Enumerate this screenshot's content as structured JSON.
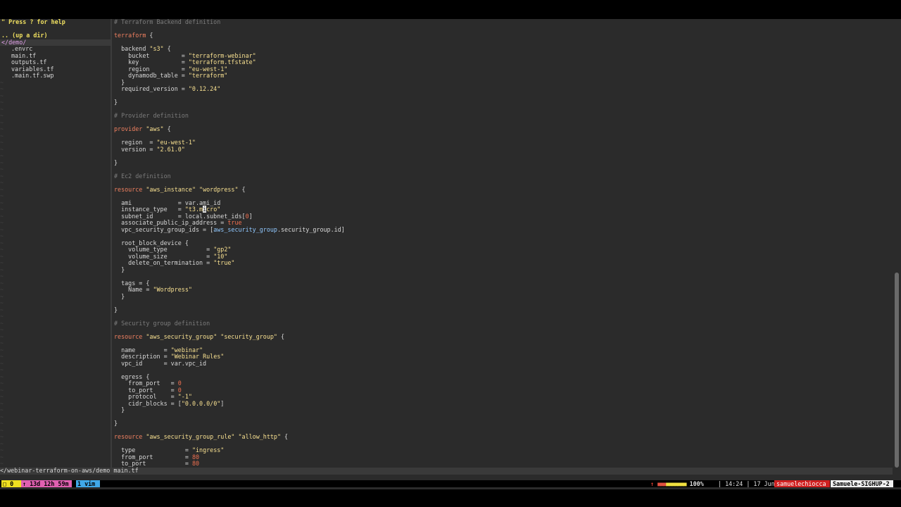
{
  "tree": {
    "help": "\" Press ? for help",
    "up_dir": ".. (up a dir)",
    "root": "</demo/",
    "files": [
      ".envrc",
      "main.tf",
      "outputs.tf",
      "variables.tf",
      ".main.tf.swp"
    ]
  },
  "code_lines": [
    [
      {
        "c": "c-comment",
        "t": "# Terraform Backend definition"
      }
    ],
    [],
    [
      {
        "c": "c-kw",
        "t": "terraform"
      },
      {
        "c": "c-plain",
        "t": " {"
      }
    ],
    [],
    [
      {
        "c": "c-plain",
        "t": "  backend "
      },
      {
        "c": "c-str",
        "t": "\"s3\""
      },
      {
        "c": "c-plain",
        "t": " {"
      }
    ],
    [
      {
        "c": "c-plain",
        "t": "    bucket         = "
      },
      {
        "c": "c-str",
        "t": "\"terraform-webinar\""
      }
    ],
    [
      {
        "c": "c-plain",
        "t": "    key            = "
      },
      {
        "c": "c-str",
        "t": "\"terraform.tfstate\""
      }
    ],
    [
      {
        "c": "c-plain",
        "t": "    region         = "
      },
      {
        "c": "c-str",
        "t": "\"eu-west-1\""
      }
    ],
    [
      {
        "c": "c-plain",
        "t": "    dynamodb_table = "
      },
      {
        "c": "c-str",
        "t": "\"terraform\""
      }
    ],
    [
      {
        "c": "c-plain",
        "t": "  }"
      }
    ],
    [
      {
        "c": "c-plain",
        "t": "  required_version = "
      },
      {
        "c": "c-str",
        "t": "\"0.12.24\""
      }
    ],
    [],
    [
      {
        "c": "c-plain",
        "t": "}"
      }
    ],
    [],
    [
      {
        "c": "c-comment",
        "t": "# Provider definition"
      }
    ],
    [],
    [
      {
        "c": "c-kw",
        "t": "provider"
      },
      {
        "c": "c-plain",
        "t": " "
      },
      {
        "c": "c-str",
        "t": "\"aws\""
      },
      {
        "c": "c-plain",
        "t": " {"
      }
    ],
    [],
    [
      {
        "c": "c-plain",
        "t": "  region  = "
      },
      {
        "c": "c-str",
        "t": "\"eu-west-1\""
      }
    ],
    [
      {
        "c": "c-plain",
        "t": "  version = "
      },
      {
        "c": "c-str",
        "t": "\"2.61.0\""
      }
    ],
    [],
    [
      {
        "c": "c-plain",
        "t": "}"
      }
    ],
    [],
    [
      {
        "c": "c-comment",
        "t": "# Ec2 definition"
      }
    ],
    [],
    [
      {
        "c": "c-kw",
        "t": "resource"
      },
      {
        "c": "c-plain",
        "t": " "
      },
      {
        "c": "c-str",
        "t": "\"aws_instance\""
      },
      {
        "c": "c-plain",
        "t": " "
      },
      {
        "c": "c-str",
        "t": "\"wordpress\""
      },
      {
        "c": "c-plain",
        "t": " {"
      }
    ],
    [],
    [
      {
        "c": "c-plain",
        "t": "  ami             = var.ami_id"
      }
    ],
    [
      {
        "c": "c-plain",
        "t": "  instance_type   = "
      },
      {
        "c": "c-str",
        "t": "\"t3.m"
      },
      {
        "c": "cursor",
        "t": "i"
      },
      {
        "c": "c-str",
        "t": "cro\""
      }
    ],
    [
      {
        "c": "c-plain",
        "t": "  subnet_id       = local.subnet_ids["
      },
      {
        "c": "c-num",
        "t": "0"
      },
      {
        "c": "c-plain",
        "t": "]"
      }
    ],
    [
      {
        "c": "c-plain",
        "t": "  associate_public_ip_address = "
      },
      {
        "c": "c-bool",
        "t": "true"
      }
    ],
    [
      {
        "c": "c-plain",
        "t": "  vpc_security_group_ids = ["
      },
      {
        "c": "c-ref",
        "t": "aws_security_group"
      },
      {
        "c": "c-plain",
        "t": ".security_group.id]"
      }
    ],
    [],
    [
      {
        "c": "c-plain",
        "t": "  root_block_device {"
      }
    ],
    [
      {
        "c": "c-plain",
        "t": "    volume_type           = "
      },
      {
        "c": "c-str",
        "t": "\"gp2\""
      }
    ],
    [
      {
        "c": "c-plain",
        "t": "    volume_size           = "
      },
      {
        "c": "c-str",
        "t": "\"10\""
      }
    ],
    [
      {
        "c": "c-plain",
        "t": "    delete_on_termination = "
      },
      {
        "c": "c-str",
        "t": "\"true\""
      }
    ],
    [
      {
        "c": "c-plain",
        "t": "  }"
      }
    ],
    [],
    [
      {
        "c": "c-plain",
        "t": "  tags = {"
      }
    ],
    [
      {
        "c": "c-plain",
        "t": "    Name = "
      },
      {
        "c": "c-str",
        "t": "\"Wordpress\""
      }
    ],
    [
      {
        "c": "c-plain",
        "t": "  }"
      }
    ],
    [],
    [
      {
        "c": "c-plain",
        "t": "}"
      }
    ],
    [],
    [
      {
        "c": "c-comment",
        "t": "# Security group definition"
      }
    ],
    [],
    [
      {
        "c": "c-kw",
        "t": "resource"
      },
      {
        "c": "c-plain",
        "t": " "
      },
      {
        "c": "c-str",
        "t": "\"aws_security_group\""
      },
      {
        "c": "c-plain",
        "t": " "
      },
      {
        "c": "c-str",
        "t": "\"security_group\""
      },
      {
        "c": "c-plain",
        "t": " {"
      }
    ],
    [],
    [
      {
        "c": "c-plain",
        "t": "  name        = "
      },
      {
        "c": "c-str",
        "t": "\"webinar\""
      }
    ],
    [
      {
        "c": "c-plain",
        "t": "  description = "
      },
      {
        "c": "c-str",
        "t": "\"Webinar Rules\""
      }
    ],
    [
      {
        "c": "c-plain",
        "t": "  vpc_id      = var.vpc_id"
      }
    ],
    [],
    [
      {
        "c": "c-plain",
        "t": "  egress {"
      }
    ],
    [
      {
        "c": "c-plain",
        "t": "    from_port   = "
      },
      {
        "c": "c-num",
        "t": "0"
      }
    ],
    [
      {
        "c": "c-plain",
        "t": "    to_port     = "
      },
      {
        "c": "c-num",
        "t": "0"
      }
    ],
    [
      {
        "c": "c-plain",
        "t": "    protocol    = "
      },
      {
        "c": "c-str",
        "t": "\"-1\""
      }
    ],
    [
      {
        "c": "c-plain",
        "t": "    cidr_blocks = ["
      },
      {
        "c": "c-str",
        "t": "\"0.0.0.0/0\""
      },
      {
        "c": "c-plain",
        "t": "]"
      }
    ],
    [
      {
        "c": "c-plain",
        "t": "  }"
      }
    ],
    [],
    [
      {
        "c": "c-plain",
        "t": "}"
      }
    ],
    [],
    [
      {
        "c": "c-kw",
        "t": "resource"
      },
      {
        "c": "c-plain",
        "t": " "
      },
      {
        "c": "c-str",
        "t": "\"aws_security_group_rule\""
      },
      {
        "c": "c-plain",
        "t": " "
      },
      {
        "c": "c-str",
        "t": "\"allow_http\""
      },
      {
        "c": "c-plain",
        "t": " {"
      }
    ],
    [],
    [
      {
        "c": "c-plain",
        "t": "  type              = "
      },
      {
        "c": "c-str",
        "t": "\"ingress\""
      }
    ],
    [
      {
        "c": "c-plain",
        "t": "  from_port         = "
      },
      {
        "c": "c-num",
        "t": "80"
      }
    ],
    [
      {
        "c": "c-plain",
        "t": "  to_port           = "
      },
      {
        "c": "c-num",
        "t": "80"
      }
    ]
  ],
  "vim_status": {
    "path": "</webinar-terraform-on-aws/demo ",
    "file": "main.tf"
  },
  "tmux": {
    "session": "□ 0",
    "uptime": "↑ 13d 12h 59m",
    "window": "1 vim",
    "battery_icon": "↑",
    "battery_level": 1.0,
    "battery_pct": "100%",
    "time": "| 14:24 | 17 Jun",
    "user": "samuelechiocca",
    "host": "Samuele-SIGHUP-2"
  },
  "colors": {
    "background": "#2b2b2b",
    "comment": "#7c7c7c",
    "keyword": "#f08060",
    "string": "#f8e090",
    "number": "#f07050"
  }
}
